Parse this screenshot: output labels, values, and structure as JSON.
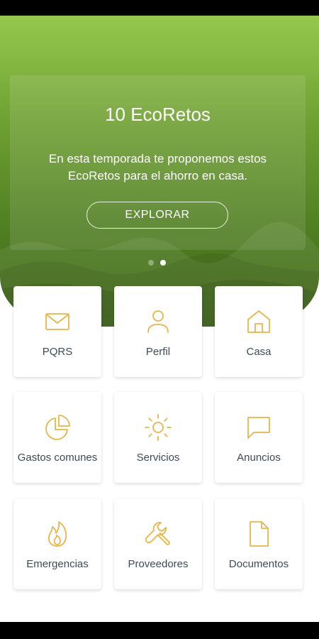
{
  "banner": {
    "title": "10 EcoRetos",
    "description": "En esta temporada te proponemos estos EcoRetos para el ahorro en casa.",
    "button_label": "EXPLORAR",
    "pagination": {
      "total": 2,
      "active": 2
    }
  },
  "colors": {
    "accent": "#e8b54a",
    "hero_top": "#95c84e",
    "hero_bottom": "#40691a",
    "label": "#3f4a54"
  },
  "menu": {
    "items": [
      {
        "label": "PQRS",
        "icon": "mail-icon"
      },
      {
        "label": "Perfil",
        "icon": "user-icon"
      },
      {
        "label": "Casa",
        "icon": "home-icon"
      },
      {
        "label": "Gastos comunes",
        "icon": "pie-chart-icon"
      },
      {
        "label": "Servicios",
        "icon": "sun-icon"
      },
      {
        "label": "Anuncios",
        "icon": "message-icon"
      },
      {
        "label": "Emergencias",
        "icon": "flame-icon"
      },
      {
        "label": "Proveedores",
        "icon": "wrench-icon"
      },
      {
        "label": "Documentos",
        "icon": "document-icon"
      }
    ]
  }
}
